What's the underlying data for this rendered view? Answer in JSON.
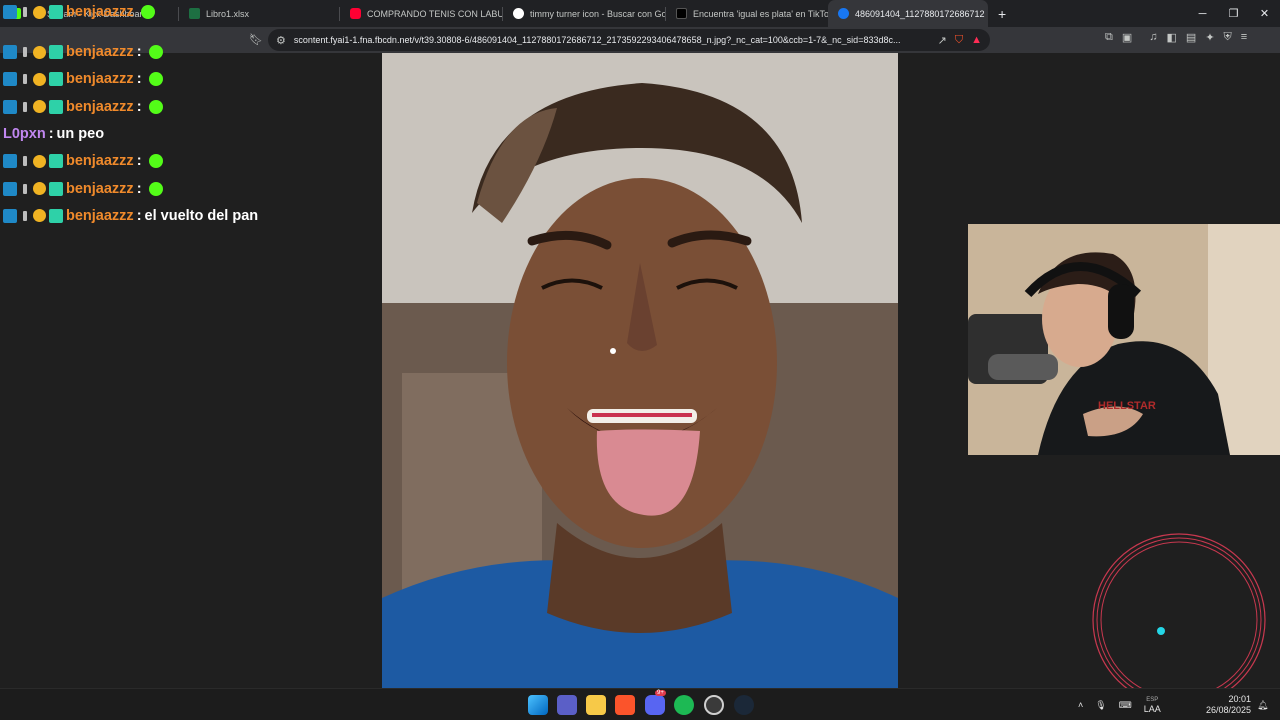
{
  "browser": {
    "tabs": [
      {
        "label": "Stream - Kick Dashboard",
        "color": "#53fc18"
      },
      {
        "label": "Libro1.xlsx",
        "color": "#1d6f42"
      },
      {
        "label": "COMPRANDO TENIS CON LABUBU",
        "color": "#ff0033"
      },
      {
        "label": "timmy turner icon - Buscar con Goo...",
        "color": "#ffffff"
      },
      {
        "label": "Encuentra 'igual es plata' en TikTok |",
        "color": "#000000"
      },
      {
        "label": "486091404_1127880172686712",
        "color": "#1877f2",
        "active": true
      }
    ],
    "new_tab": "+",
    "url": "scontent.fyai1-1.fna.fbcdn.net/v/t39.30808-6/486091404_1127880172686712_2173592293406478658_n.jpg?_nc_cat=100&ccb=1-7&_nc_sid=833d8c..."
  },
  "chat": {
    "messages": [
      {
        "user": "benjaazzz",
        "sep": ":",
        "text": "",
        "emote": true,
        "color": "#f08a2b"
      },
      {
        "user": "benjaazzz",
        "sep": ":",
        "text": "",
        "emote": true,
        "color": "#f08a2b"
      },
      {
        "user": "benjaazzz",
        "sep": ":",
        "text": "",
        "emote": true,
        "color": "#f08a2b"
      },
      {
        "user": "L0pxn",
        "sep": ":",
        "text": "un peo",
        "emote": false,
        "color": "#c187f0"
      },
      {
        "user": "benjaazzz",
        "sep": ":",
        "text": "",
        "emote": true,
        "color": "#f08a2b"
      },
      {
        "user": "benjaazzz",
        "sep": ":",
        "text": "",
        "emote": true,
        "color": "#f08a2b"
      },
      {
        "user": "benjaazzz",
        "sep": ":",
        "text": "el vuelto del pan",
        "emote": false,
        "color": "#f08a2b"
      }
    ],
    "overlap_user": "benjaazzz"
  },
  "taskbar": {
    "lang": "LAA",
    "lang_top": "ESP",
    "time": "20:01",
    "date": "26/08/2025",
    "discord_badge": "9+"
  },
  "colors": {
    "kick_green": "#53fc18",
    "ring": "#c8384f",
    "cursor_dot": "#24d6e6"
  }
}
